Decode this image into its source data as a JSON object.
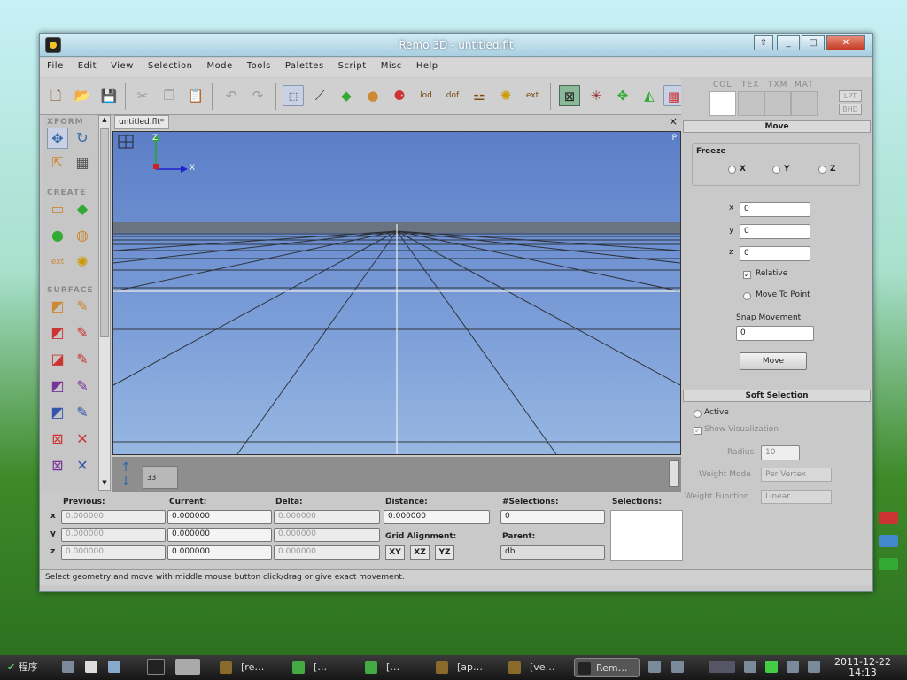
{
  "window": {
    "title": "Remo 3D - untitled.flt"
  },
  "menu": [
    "File",
    "Edit",
    "View",
    "Selection",
    "Mode",
    "Tools",
    "Palettes",
    "Script",
    "Misc",
    "Help"
  ],
  "tabs": {
    "col": "COL",
    "tex": "TEX",
    "txm": "TXM",
    "mat": "MAT",
    "lpt": "LPT",
    "bhd": "BHD"
  },
  "palette": {
    "xform": "XFORM",
    "create": "CREATE",
    "surface": "SURFACE"
  },
  "viewport": {
    "tab": "untitled.flt*",
    "close": "×",
    "persp": "P",
    "axis_z": "Z",
    "axis_x": "X"
  },
  "cmd": {
    "input": "33"
  },
  "coords": {
    "previous": "Previous:",
    "current": "Current:",
    "delta": "Delta:",
    "distance": "Distance:",
    "selections_count": "#Selections:",
    "selections": "Selections:",
    "grid_alignment": "Grid Alignment:",
    "parent": "Parent:",
    "row_labels": [
      "x",
      "y",
      "z"
    ],
    "prev": [
      "0.000000",
      "0.000000",
      "0.000000"
    ],
    "cur": [
      "0.000000",
      "0.000000",
      "0.000000"
    ],
    "del": [
      "0.000000",
      "0.000000",
      "0.000000"
    ],
    "distance_val": "0.000000",
    "count_val": "0",
    "parent_val": "db",
    "xy": "XY",
    "xz": "XZ",
    "yz": "YZ"
  },
  "move": {
    "header": "Move",
    "freeze": "Freeze",
    "fx": "X",
    "fy": "Y",
    "fz": "Z",
    "x": "0",
    "y": "0",
    "z": "0",
    "xl": "x",
    "yl": "y",
    "zl": "z",
    "relative": "Relative",
    "move_to_point": "Move To Point",
    "snap": "Snap Movement",
    "snap_val": "0",
    "button": "Move"
  },
  "soft": {
    "header": "Soft Selection",
    "active": "Active",
    "show_vis": "Show Visualization",
    "radius_label": "Radius",
    "radius": "10",
    "weight_mode_label": "Weight Mode",
    "weight_mode": "Per Vertex",
    "weight_func_label": "Weight Function",
    "weight_func": "Linear"
  },
  "status": "Select geometry and move with middle mouse button click/drag or give exact movement.",
  "taskbar": {
    "start": "程序",
    "t1": "[re…",
    "t2": "[…",
    "t3": "[…",
    "t4": "[ap…",
    "t5": "[ve…",
    "t6": "Rem…",
    "date": "2011-12-22",
    "time": "14:13"
  }
}
